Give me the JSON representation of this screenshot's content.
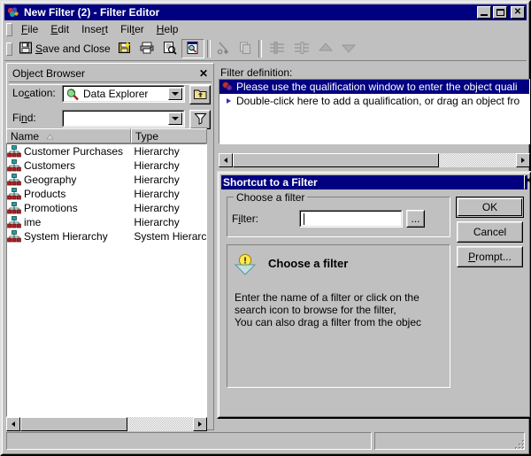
{
  "window": {
    "title": "New Filter (2) - Filter Editor",
    "app_icon": "filter-editor-icon",
    "minimize_label": "Minimize",
    "maximize_label": "Maximize",
    "close_label": "Close"
  },
  "menubar": {
    "items": [
      {
        "label": "File",
        "accel": "F"
      },
      {
        "label": "Edit",
        "accel": "E"
      },
      {
        "label": "Insert",
        "accel": "r"
      },
      {
        "label": "Filter",
        "accel": "t"
      },
      {
        "label": "Help",
        "accel": "H"
      }
    ]
  },
  "toolbar": {
    "save_and_close_label": "Save and Close",
    "save_and_close_accel": "S",
    "buttons": [
      {
        "name": "save-and-close-button",
        "icon": "floppy-disk-icon",
        "enabled": true
      },
      {
        "name": "save-as-button",
        "icon": "floppy-disk-new-icon",
        "enabled": true
      },
      {
        "name": "print-button",
        "icon": "printer-icon",
        "enabled": true
      },
      {
        "name": "print-preview-button",
        "icon": "print-preview-icon",
        "enabled": true
      },
      {
        "name": "object-browser-toggle-button",
        "icon": "object-browser-icon",
        "enabled": true,
        "pressed": true
      },
      {
        "name": "cut-button",
        "icon": "cut-icon",
        "enabled": false
      },
      {
        "name": "copy-button",
        "icon": "copy-icon",
        "enabled": false
      },
      {
        "name": "group-button",
        "icon": "group-icon",
        "enabled": false
      },
      {
        "name": "ungroup-button",
        "icon": "ungroup-icon",
        "enabled": false
      },
      {
        "name": "move-up-button",
        "icon": "arrow-up-icon",
        "enabled": false
      },
      {
        "name": "move-down-button",
        "icon": "arrow-down-icon",
        "enabled": false
      }
    ]
  },
  "object_browser": {
    "title": "Object Browser",
    "close_label": "x",
    "location_label": "Location:",
    "location_accel": "c",
    "location_value": "Data Explorer",
    "location_icon": "data-explorer-icon",
    "up_button_icon": "up-one-level-icon",
    "find_label": "Find:",
    "find_accel": "n",
    "find_value": "",
    "filter_button_icon": "funnel-icon",
    "columns": [
      {
        "label": "Name",
        "sort": "ascending"
      },
      {
        "label": "Type",
        "sort": ""
      }
    ],
    "items": [
      {
        "name": "Customer Purchases",
        "type": "Hierarchy",
        "icon": "hierarchy-icon"
      },
      {
        "name": "Customers",
        "type": "Hierarchy",
        "icon": "hierarchy-icon"
      },
      {
        "name": "Geography",
        "type": "Hierarchy",
        "icon": "hierarchy-icon"
      },
      {
        "name": "Products",
        "type": "Hierarchy",
        "icon": "hierarchy-icon"
      },
      {
        "name": "Promotions",
        "type": "Hierarchy",
        "icon": "hierarchy-icon"
      },
      {
        "name": "ime",
        "type": "Hierarchy",
        "icon": "hierarchy-icon"
      },
      {
        "name": "System Hierarchy",
        "type": "System Hierarc",
        "icon": "hierarchy-icon"
      }
    ],
    "hscroll": {
      "left_arrow": "◄",
      "right_arrow": "►"
    }
  },
  "filter_definition": {
    "label": "Filter definition:",
    "rows": [
      {
        "text": "Please use the qualification window to enter the object quali",
        "icon": "filter-qualification-icon",
        "selected": true
      },
      {
        "text": "Double-click here to add a qualification, or drag an object fro",
        "icon": "blue-triangle-bullet-icon",
        "selected": false
      }
    ],
    "hscroll": {
      "left_arrow": "◄",
      "right_arrow": "►"
    }
  },
  "dialog": {
    "title": "Shortcut to a Filter",
    "close_label": "x",
    "group_caption": "Choose a filter",
    "filter_label": "Filter:",
    "filter_accel": "i",
    "filter_value": "",
    "filter_placeholder": "",
    "browse_button_label": "...",
    "buttons": [
      {
        "name": "ok-button",
        "label": "OK",
        "default": true
      },
      {
        "name": "cancel-button",
        "label": "Cancel",
        "default": false
      },
      {
        "name": "prompt-button",
        "label": "Prompt...",
        "accel": "P",
        "default": false
      }
    ],
    "help": {
      "icon": "lightbulb-tip-icon",
      "title": "Choose a filter",
      "lines": [
        "Enter the name of a filter or click on the",
        "search icon to browse for the filter,",
        "You can also drag a filter from the objec"
      ]
    }
  },
  "statusbar": {
    "left_text": "",
    "right_text": "",
    "resize_grip": "resize-grip-icon"
  },
  "colors": {
    "titlebar": "#000080",
    "face": "#c0c0c0",
    "selection": "#000080",
    "window": "#ffffff",
    "tip_yellow": "#ffe84d",
    "hierarchy_teal": "#2a9d9d",
    "hierarchy_red": "#b02020"
  }
}
